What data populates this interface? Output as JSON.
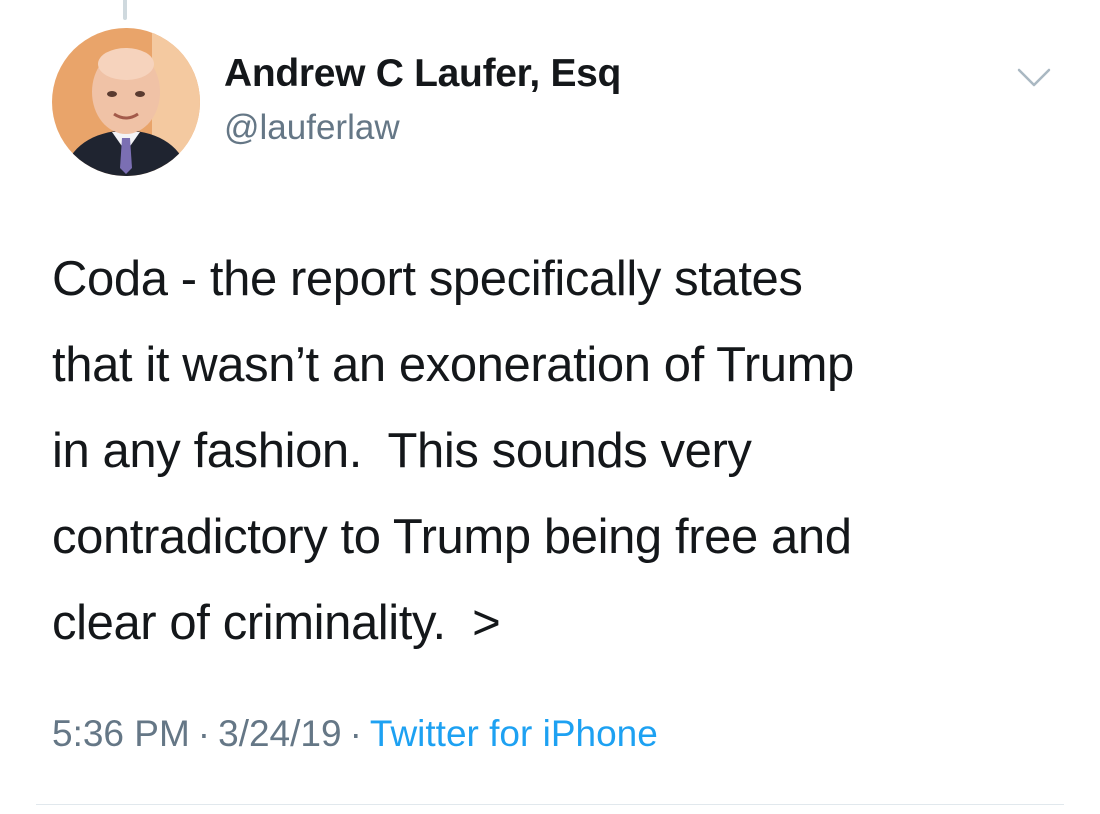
{
  "tweet": {
    "author": {
      "display_name": "Andrew C Laufer, Esq",
      "handle": "@lauferlaw",
      "avatar_icon": "profile-photo"
    },
    "menu_icon": "chevron-down-icon",
    "text_lines": [
      "Coda - the report specifically states",
      "that it wasn’t an exoneration of Trump",
      "in any fashion.  This sounds very",
      "contradictory to Trump being free and",
      "clear of criminality.  >"
    ],
    "time": "5:36 PM",
    "separator": "·",
    "date": "3/24/19",
    "source": "Twitter for iPhone"
  },
  "colors": {
    "text": "#14171a",
    "secondary": "#657786",
    "link": "#1da1f2",
    "divider": "#e1e8ed",
    "thread_line": "#cfd9de"
  }
}
